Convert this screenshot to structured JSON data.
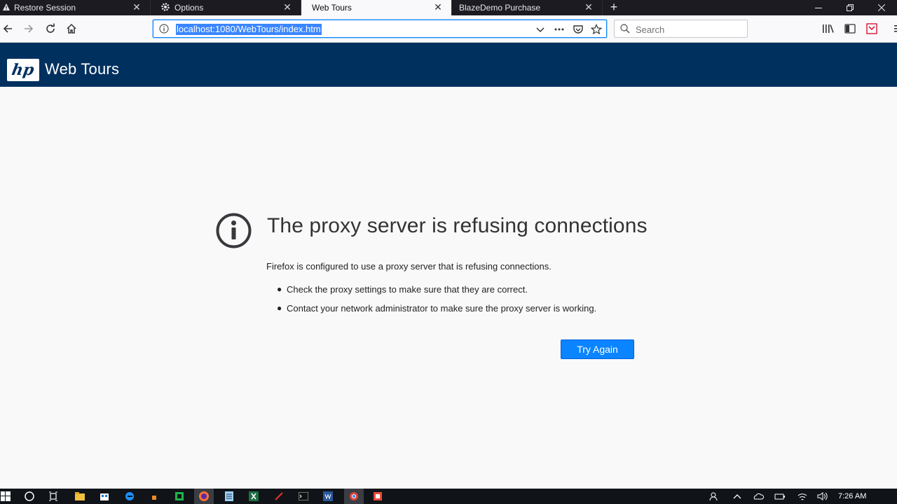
{
  "tabs": [
    {
      "label": "Restore Session",
      "icon": "warning-icon"
    },
    {
      "label": "Options",
      "icon": "gear-icon"
    },
    {
      "label": "Web Tours",
      "icon": "",
      "active": true
    },
    {
      "label": "BlazeDemo Purchase",
      "icon": ""
    }
  ],
  "newtab_symbol": "+",
  "url": "localhost:1080/WebTours/index.htm",
  "search": {
    "placeholder": "Search"
  },
  "site": {
    "logo_text": "hp",
    "title": "Web Tours"
  },
  "error": {
    "title": "The proxy server is refusing connections",
    "description": "Firefox is configured to use a proxy server that is refusing connections.",
    "bullets": [
      "Check the proxy settings to make sure that they are correct.",
      "Contact your network administrator to make sure the proxy server is working."
    ],
    "button": "Try Again"
  },
  "taskbar": {
    "clock": "7:26 AM"
  },
  "colors": {
    "accent": "#0a84ff",
    "header": "#00305e",
    "tabstrip": "#1c1b22"
  }
}
